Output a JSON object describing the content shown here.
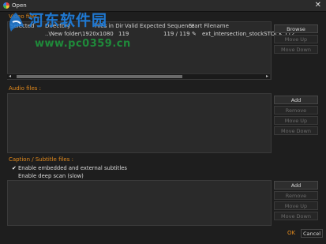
{
  "window": {
    "title": "Open",
    "close_glyph": "✕"
  },
  "video": {
    "section_label": "Video files :",
    "columns": [
      "Selected",
      "Directory",
      "Files in Dir",
      "Valid",
      "Expected Sequence",
      "Start Filename"
    ],
    "row": {
      "directory": "..\\New folder\\1920x1080",
      "files_in_dir": "119",
      "expected_sequence": "119 / 119",
      "start_filename": "ext_intersection_stockSTOCK.112..."
    },
    "buttons": {
      "browse": "Browse",
      "move_up": "Move Up",
      "move_down": "Move Down"
    }
  },
  "audio": {
    "section_label": "Audio files :",
    "buttons": {
      "add": "Add",
      "remove": "Remove",
      "move_up": "Move Up",
      "move_down": "Move Down"
    }
  },
  "captions": {
    "section_label": "Caption / Subtitle files :",
    "options": [
      {
        "label": "Enable embedded and external subtitles",
        "checked": true
      },
      {
        "label": "Enable deep scan (slow)",
        "checked": false
      }
    ],
    "buttons": {
      "add": "Add",
      "remove": "Remove",
      "move_up": "Move Up",
      "move_down": "Move Down"
    }
  },
  "footer": {
    "ok": "OK",
    "cancel": "Cancel"
  },
  "watermark": {
    "line1": "河东软件园",
    "line2": "www.pc0359.cn"
  },
  "colors": {
    "accent": "#e38a1c",
    "background": "#1e1e1e",
    "panel": "#2a2a2a"
  }
}
